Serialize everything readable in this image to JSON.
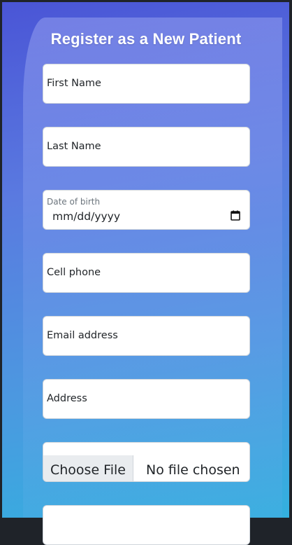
{
  "form": {
    "title": "Register as a New Patient",
    "first_name_placeholder": "First Name",
    "last_name_placeholder": "Last Name",
    "dob_label": "Date of birth",
    "dob_value": "mm/dd/yyyy",
    "cell_phone_placeholder": "Cell phone",
    "email_placeholder": "Email address",
    "address_placeholder": "Address",
    "file_button_label": "Choose File",
    "file_status": "No file chosen"
  },
  "icons": {
    "calendar": "calendar-icon"
  },
  "colors": {
    "gradient_top": "#4a55d6",
    "gradient_bottom": "#33b0df",
    "field_bg": "#ffffff",
    "file_button_bg": "#e9ecef"
  }
}
